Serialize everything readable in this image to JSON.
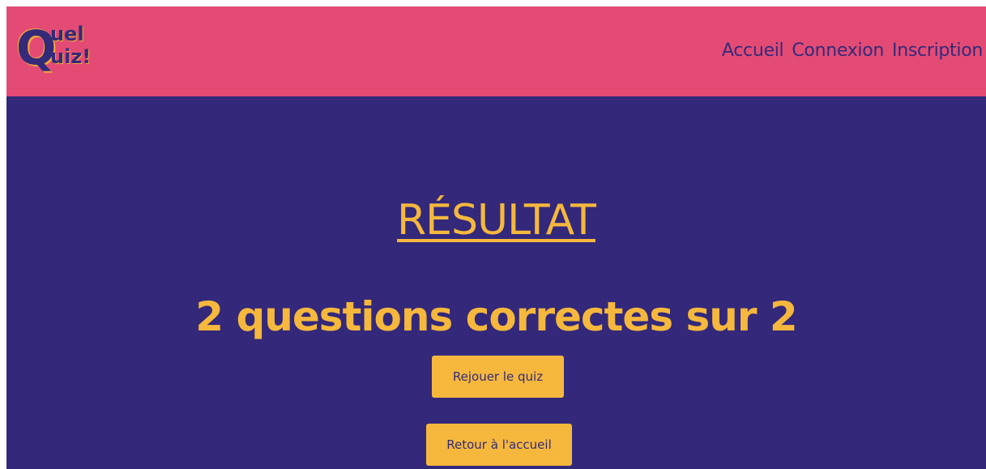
{
  "header": {
    "logo": {
      "big_letter": "Q",
      "line1": "uel",
      "line2": "uiz!"
    },
    "nav": [
      "Accueil",
      "Connexion",
      "Inscription"
    ]
  },
  "main": {
    "title": "RÉSULTAT",
    "score_text": "2 questions correctes sur 2",
    "buttons": {
      "replay": "Rejouer le quiz",
      "home": "Retour à l'accueil"
    }
  },
  "colors": {
    "header_bg": "#e34b75",
    "main_bg": "#33287a",
    "accent": "#f5b83d",
    "text_dark": "#332a7a"
  }
}
